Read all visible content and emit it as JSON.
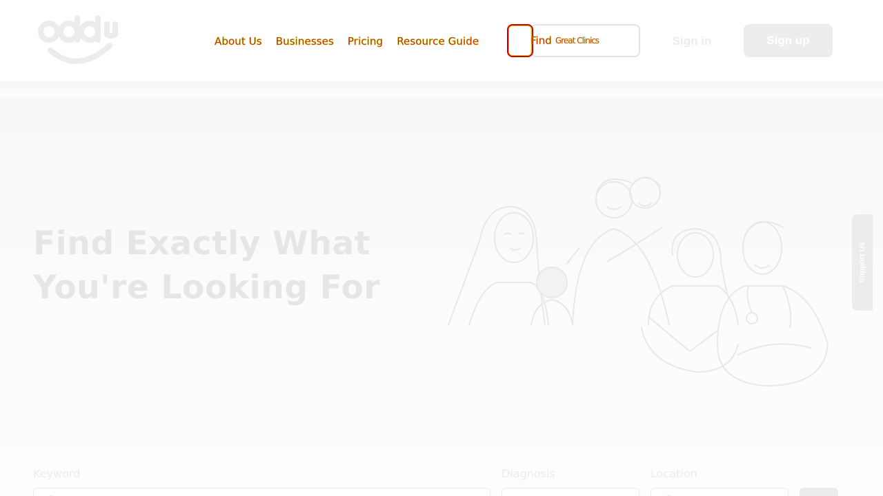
{
  "header": {
    "logo_text": "oddy",
    "nav": [
      {
        "label": "About Us"
      },
      {
        "label": "Businesses"
      },
      {
        "label": "Pricing"
      },
      {
        "label": "Resource Guide"
      }
    ],
    "find_button": {
      "label": "Find",
      "overlay_text": "Great Clinics"
    },
    "signin_label": "Sign in",
    "signup_label": "Sign up"
  },
  "hero": {
    "title_line1": "Find Exactly What",
    "title_line2": "You're Looking For",
    "illustration_icon": "people-group-illustration"
  },
  "support_tab": {
    "label": "Support Us"
  },
  "search": {
    "keyword_label": "Keyword",
    "diagnosis_label": "Diagnosis",
    "location_label": "Location"
  },
  "colors": {
    "nav_text": "#c00000",
    "nav_outline": "#c7a800",
    "faded_gray": "#e6e6e6",
    "signup_bg": "#ededed"
  }
}
